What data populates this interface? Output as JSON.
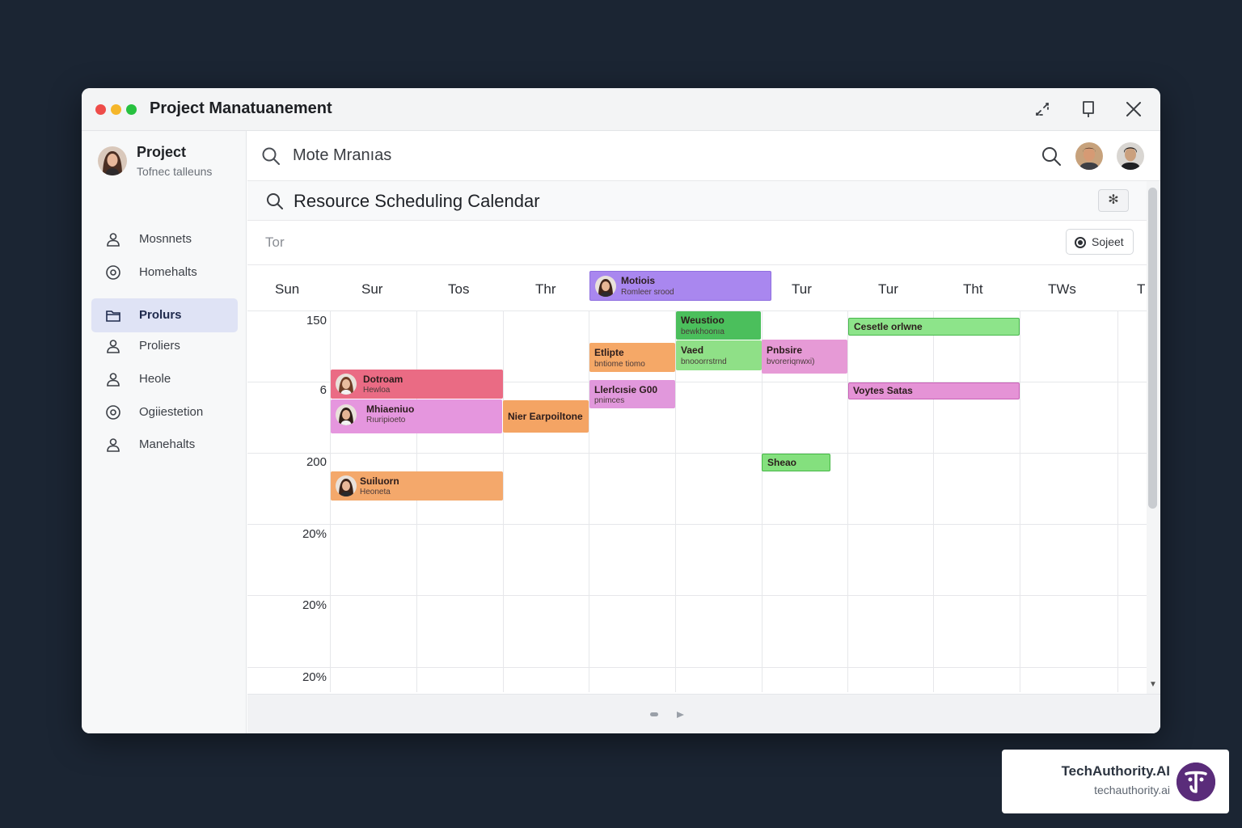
{
  "window": {
    "title": "Project Manatuanement"
  },
  "sidebar": {
    "profile_title": "Project",
    "profile_subtitle": "Tofnec talleuns",
    "items": [
      {
        "label": "Mosnnets",
        "icon": "user-icon",
        "active": false
      },
      {
        "label": "Homehalts",
        "icon": "circle-target-icon",
        "active": false
      },
      {
        "label": "Prolurs",
        "icon": "folder-icon",
        "active": true
      },
      {
        "label": "Proliers",
        "icon": "user-icon",
        "active": false
      },
      {
        "label": "Heole",
        "icon": "user-icon",
        "active": false
      },
      {
        "label": "Ogiiestetion",
        "icon": "circle-target-icon",
        "active": false
      },
      {
        "label": "Manehalts",
        "icon": "user-icon",
        "active": false
      }
    ]
  },
  "topbar": {
    "search_value": "Mote Mranıas"
  },
  "calendar": {
    "title": "Resource Scheduling Calendar",
    "star_label": "✻",
    "filter_text": "Tor",
    "select_label": "Sojeet",
    "days": [
      "Sun",
      "Sur",
      "Tos",
      "Thr",
      "",
      "",
      "Tur",
      "Tur",
      "Tht",
      "TWs",
      "T"
    ],
    "row_labels": [
      "150",
      "6",
      "200",
      "20%",
      "20%",
      "20%"
    ],
    "events": [
      {
        "title": "Motiois",
        "subtitle": "Romleer srood",
        "color": "#a987ef"
      },
      {
        "title": "Weustioo",
        "subtitle": "bewkhoonıa",
        "color": "#4bbf5c"
      },
      {
        "title": "Cesetle orlwne",
        "subtitle": "",
        "color": "#8de48a"
      },
      {
        "title": "Etlipte",
        "subtitle": "bntiome tiomo",
        "color": "#f5a867"
      },
      {
        "title": "Vaed",
        "subtitle": "bnooorrstrnd",
        "color": "#8fe087"
      },
      {
        "title": "Pnbsire",
        "subtitle": "bvoreriqnwxi)",
        "color": "#e69ad6"
      },
      {
        "title": "Dotroam",
        "subtitle": "Hewloa",
        "color": "#ea6b84"
      },
      {
        "title": "Llerlcısie G00",
        "subtitle": "pnimces",
        "color": "#e198dc"
      },
      {
        "title": "Voytes Satas",
        "subtitle": "",
        "color": "#e593d6"
      },
      {
        "title": "Mhiaeniuo",
        "subtitle": "Rıuripioeto",
        "color": "#e596de"
      },
      {
        "title": "Nier Earpoiltone",
        "subtitle": "",
        "color": "#f4a464"
      },
      {
        "title": "Sheao",
        "subtitle": "",
        "color": "#84e07e"
      },
      {
        "title": "Suiluorn",
        "subtitle": "Heoneta",
        "color": "#f4a86b"
      }
    ]
  },
  "brand": {
    "name": "TechAuthority.AI",
    "url": "techauthority.ai"
  }
}
